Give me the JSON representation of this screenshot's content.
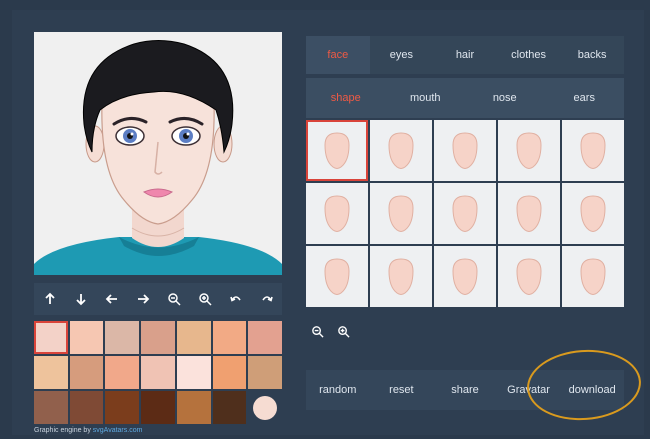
{
  "colors": {
    "background": "#2b3a4c",
    "accent": "#ef5a45",
    "selection_border": "#d9443a",
    "highlight_ring": "#d99a1e"
  },
  "tabs": [
    {
      "label": "face",
      "active": true
    },
    {
      "label": "eyes",
      "active": false
    },
    {
      "label": "hair",
      "active": false
    },
    {
      "label": "clothes",
      "active": false
    },
    {
      "label": "backs",
      "active": false
    }
  ],
  "subtabs": [
    {
      "label": "shape",
      "active": true
    },
    {
      "label": "mouth",
      "active": false
    },
    {
      "label": "nose",
      "active": false
    },
    {
      "label": "ears",
      "active": false
    }
  ],
  "toolbar_icons": [
    "arrow-up-icon",
    "arrow-down-icon",
    "arrow-left-icon",
    "arrow-right-icon",
    "zoom-out-icon",
    "zoom-in-icon",
    "undo-icon",
    "redo-icon"
  ],
  "skin_swatches": [
    [
      "#f3d2c8",
      "#f6c7b2",
      "#dbb7a7",
      "#d9a08b",
      "#e7b78d",
      "#f2aa85",
      "#e3a190"
    ],
    [
      "#eec39c",
      "#d69c7d",
      "#f1a88a",
      "#f0c3b4",
      "#fbe2dc",
      "#f0a070",
      "#cf9e78"
    ],
    [
      "#91604c",
      "#7f4a35",
      "#7b3d1c",
      "#5c2b15",
      "#b5723d",
      "#4f2f1c"
    ]
  ],
  "selected_skin": "#f6dcd2",
  "face_shape_count": 15,
  "face_shape_selected": 0,
  "zoom_icons": [
    "zoom-out-icon",
    "zoom-in-icon"
  ],
  "actions": [
    "random",
    "reset",
    "share",
    "Gravatar",
    "download"
  ],
  "credit": {
    "prefix": "Graphic engine by ",
    "link": "svgAvatars.com"
  }
}
